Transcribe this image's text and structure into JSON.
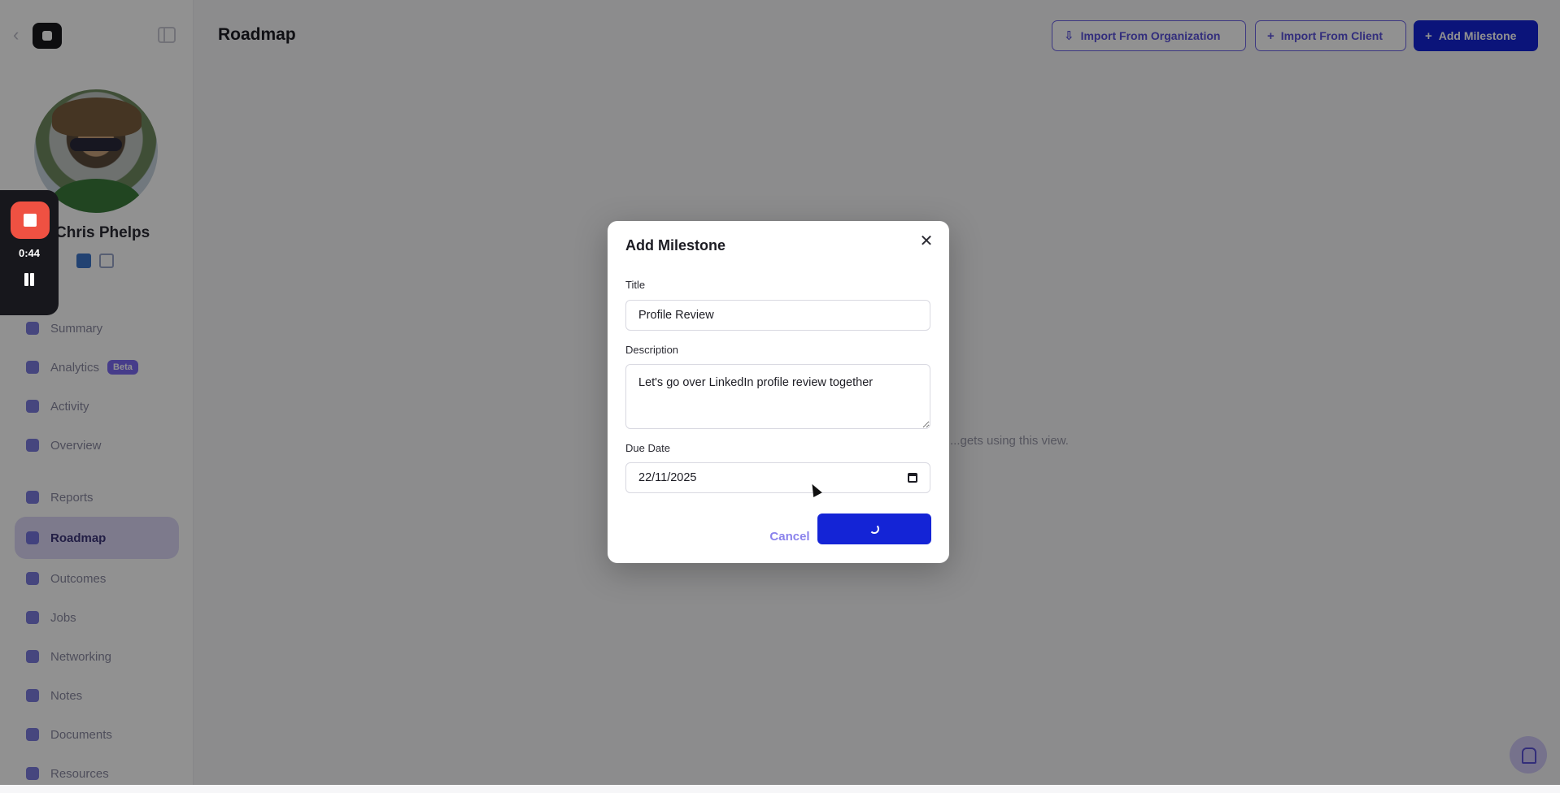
{
  "sidebar": {
    "back_glyph": "‹",
    "client_name": "Chris Phelps",
    "items": [
      {
        "label": "Summary",
        "icon": "summary-icon"
      },
      {
        "label": "Analytics",
        "icon": "analytics-icon",
        "badge": "Beta"
      },
      {
        "label": "Activity",
        "icon": "activity-icon"
      },
      {
        "label": "Overview",
        "icon": "overview-icon"
      },
      {
        "label": "Reports",
        "icon": "reports-icon"
      },
      {
        "label": "Roadmap",
        "icon": "roadmap-icon",
        "active": true
      },
      {
        "label": "Outcomes",
        "icon": "outcomes-icon"
      },
      {
        "label": "Jobs",
        "icon": "jobs-icon"
      },
      {
        "label": "Networking",
        "icon": "networking-icon"
      },
      {
        "label": "Notes",
        "icon": "notes-icon"
      },
      {
        "label": "Documents",
        "icon": "documents-icon"
      },
      {
        "label": "Resources",
        "icon": "resources-icon"
      }
    ]
  },
  "header": {
    "title": "Roadmap",
    "import_org_label": "Import From Organization",
    "import_client_label": "Import From Client",
    "add_milestone_label": "Add Milestone",
    "plus_glyph": "+",
    "import_glyph": "⇩"
  },
  "main": {
    "empty_hint": "...gets using this view."
  },
  "modal": {
    "title": "Add Milestone",
    "close_glyph": "✕",
    "title_label": "Title",
    "title_value": "Profile Review",
    "description_label": "Description",
    "description_value": "Let's go over LinkedIn profile review together",
    "due_date_label": "Due Date",
    "due_date_value": "22/11/2025",
    "cancel_label": "Cancel",
    "submit_state": "loading"
  },
  "recorder": {
    "time": "0:44"
  },
  "colors": {
    "accent": "#1424d6",
    "accent_soft": "#dcd7f7",
    "record_red": "#ef5142",
    "overlay": "rgba(0,0,0,0.43)"
  }
}
